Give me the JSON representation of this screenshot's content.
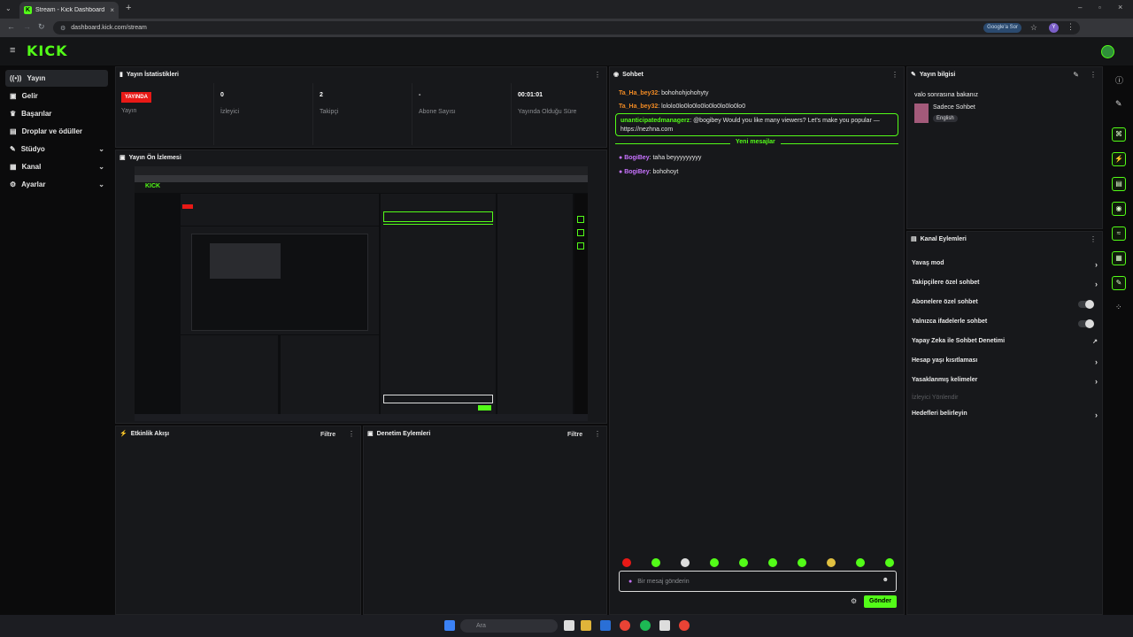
{
  "browser": {
    "tab_title": "Stream - Kick Dashboard",
    "url": "dashboard.kick.com/stream",
    "google_button": "Google'a Sor",
    "profile_letter": "Y"
  },
  "topbar": {
    "logo": "KICK"
  },
  "sidebar": {
    "items": [
      {
        "label": "Yayın"
      },
      {
        "label": "Gelir"
      },
      {
        "label": "Başarılar"
      },
      {
        "label": "Droplar ve ödüller"
      },
      {
        "label": "Stüdyo"
      },
      {
        "label": "Kanal"
      },
      {
        "label": "Ayarlar"
      }
    ]
  },
  "stats": {
    "title": "Yayın İstatistikleri",
    "live_badge": "YAYINDA",
    "live_label": "Yayın",
    "viewers_value": "0",
    "viewers_label": "İzleyici",
    "followers_value": "2",
    "followers_label": "Takipçi",
    "subs_value": "-",
    "subs_label": "Abone Sayısı",
    "uptime_value": "00:01:01",
    "uptime_label": "Yayında Olduğu Süre"
  },
  "preview": {
    "title": "Yayın Ön İzlemesi"
  },
  "activity": {
    "title": "Etkinlik Akışı",
    "filter": "Filtre"
  },
  "moderation": {
    "title": "Denetim Eylemleri",
    "filter": "Filtre"
  },
  "chat": {
    "title": "Sohbet",
    "messages": [
      {
        "user": "Ta_Ha_bey32",
        "text": ": bohohohjohohyty"
      },
      {
        "user": "Ta_Ha_bey32",
        "text": ": lololo0lo0lo0lo0lo0lo0lo0lo0lo0"
      }
    ],
    "pinned_user": "unanticipatedmanagerz",
    "pinned_text": ": @bogibey Would you like many viewers? Let's make you popular — https://nezhna.com",
    "new_messages": "Yeni mesajlar",
    "after": [
      {
        "user": "BogiBey",
        "text": ": taha beyyyyyyyyy"
      },
      {
        "user": "BogiBey",
        "text": ": bohohoyt"
      }
    ],
    "input_placeholder": "Bir mesaj gönderin",
    "send": "Gönder"
  },
  "stream_info": {
    "title": "Yayın bilgisi",
    "stream_title": "valo sonrasına bakanız",
    "category": "Sadece Sohbet",
    "language": "English"
  },
  "channel_actions": {
    "title": "Kanal Eylemleri",
    "items": [
      {
        "label": "Yavaş mod"
      },
      {
        "label": "Takipçilere özel sohbet"
      },
      {
        "label": "Abonelere özel sohbet"
      },
      {
        "label": "Yalnızca ifadelerle sohbet"
      },
      {
        "label": "Yapay Zeka ile Sohbet Denetimi"
      },
      {
        "label": "Hesap yaşı kısıtlaması"
      },
      {
        "label": "Yasaklanmış kelimeler"
      }
    ],
    "section": "İzleyici Yönlendir",
    "target": "Hedefleri belirleyin"
  },
  "taskbar": {
    "search": "Ara"
  },
  "colors": {
    "accent": "#53fc18",
    "live": "#e91916",
    "username_orange": "#f08a24",
    "username_purple": "#c873ff"
  }
}
